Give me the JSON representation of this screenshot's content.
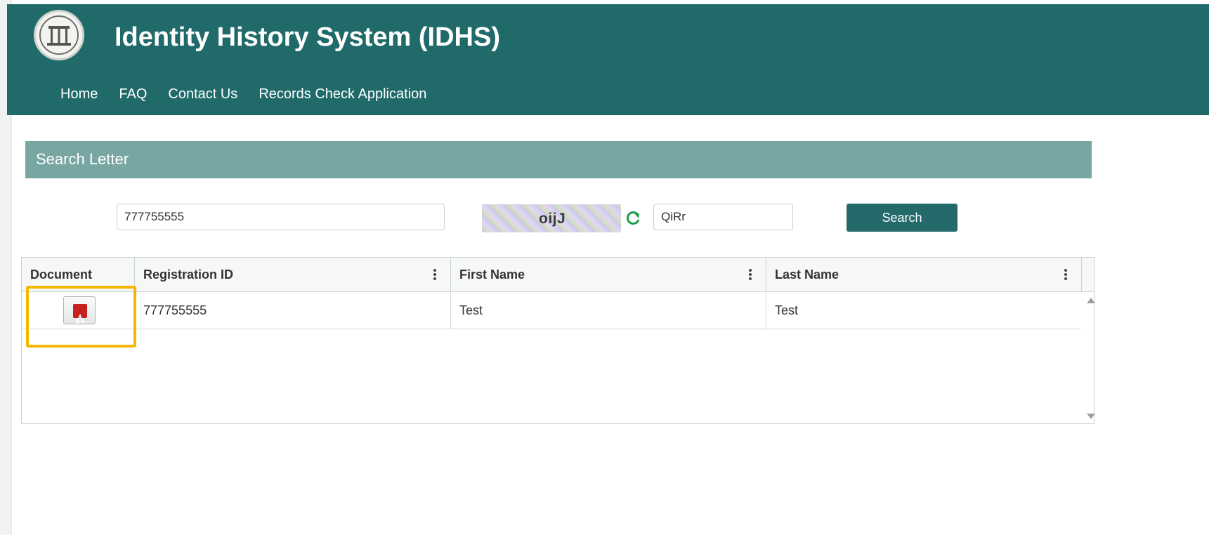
{
  "app": {
    "title": "Identity History System (IDHS)"
  },
  "nav": {
    "items": [
      "Home",
      "FAQ",
      "Contact Us",
      "Records Check Application"
    ]
  },
  "panel": {
    "title": "Search Letter"
  },
  "search": {
    "registration_value": "777755555",
    "captcha_image_text": "oijJ",
    "captcha_input_value": "QiRr",
    "button_label": "Search"
  },
  "grid": {
    "columns": [
      "Document",
      "Registration ID",
      "First Name",
      "Last Name"
    ],
    "rows": [
      {
        "registration_id": "777755555",
        "first_name": "Test",
        "last_name": "Test"
      }
    ]
  },
  "colors": {
    "header_bg": "#206a6a",
    "panel_header_bg": "#78a6a3",
    "button_bg": "#246a6b",
    "highlight_border": "#f5b600",
    "pdf_icon": "#c62020"
  },
  "icons": {
    "seal": "georgia-state-seal-icon",
    "refresh": "refresh-icon",
    "pdf": "pdf-icon",
    "column_menu": "kebab-menu-icon"
  }
}
